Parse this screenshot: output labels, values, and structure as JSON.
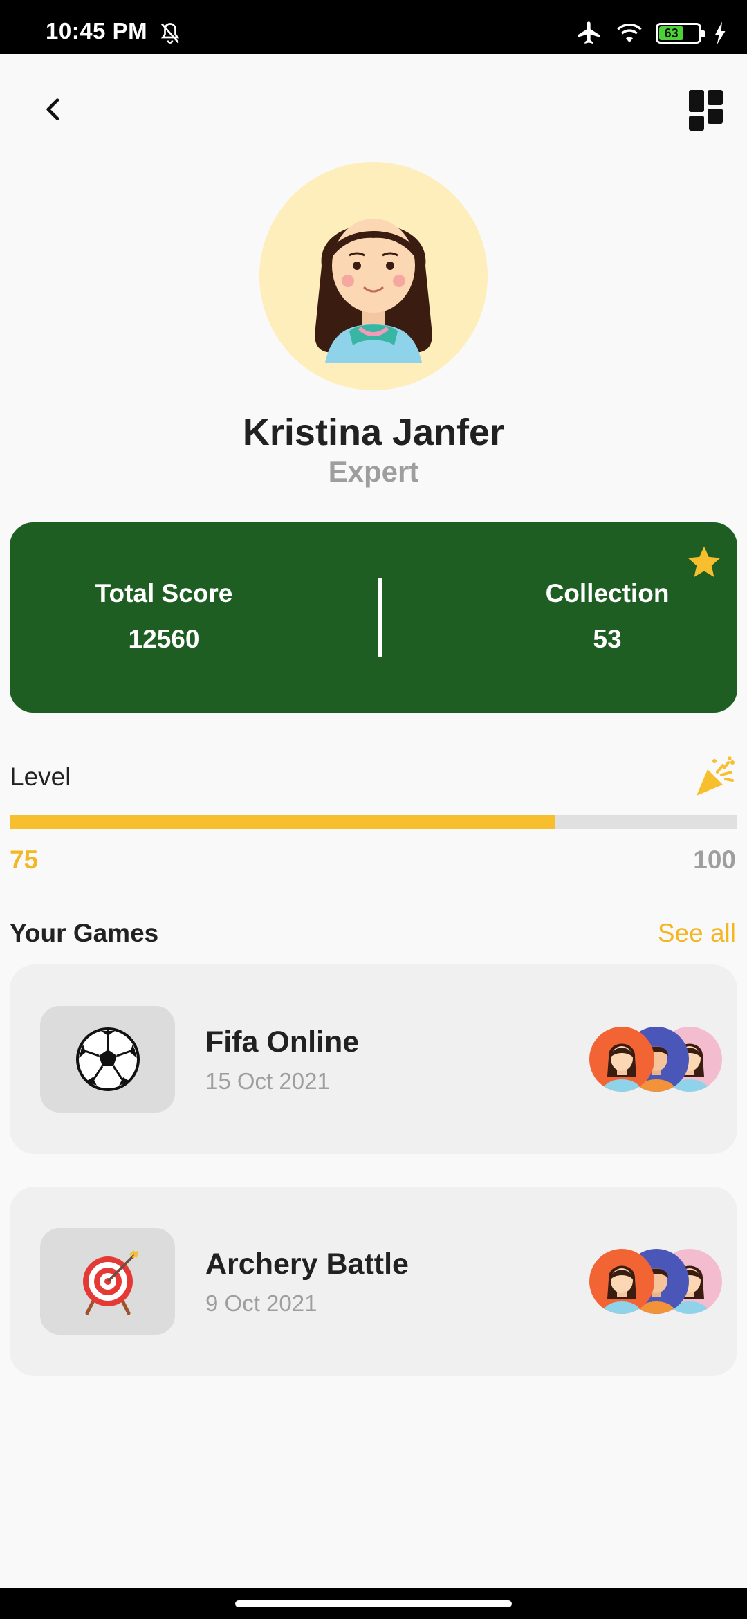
{
  "status_bar": {
    "time": "10:45 PM",
    "battery_level": 63,
    "battery_text": "63",
    "icons": [
      "bell-off-icon",
      "airplane-icon",
      "wifi-icon",
      "battery-icon",
      "charging-icon"
    ]
  },
  "header": {
    "back_icon": "chevron-left-icon",
    "menu_icon": "dashboard-grid-icon"
  },
  "profile": {
    "name": "Kristina Janfer",
    "rank": "Expert"
  },
  "stats": {
    "total_score_label": "Total Score",
    "total_score_value": "12560",
    "collection_label": "Collection",
    "collection_value": "53",
    "badge_icon": "star-icon",
    "card_color": "#1e5e23"
  },
  "level": {
    "label": "Level",
    "current": "75",
    "max": "100",
    "progress_fraction": 0.75,
    "icon": "party-popper-icon",
    "accent_color": "#f7bf2e"
  },
  "games": {
    "title": "Your Games",
    "see_all": "See all",
    "items": [
      {
        "name": "Fifa Online",
        "date": "15 Oct 2021",
        "icon": "soccer-ball-icon"
      },
      {
        "name": "Archery Battle",
        "date": "9 Oct 2021",
        "icon": "archery-target-icon"
      }
    ]
  }
}
